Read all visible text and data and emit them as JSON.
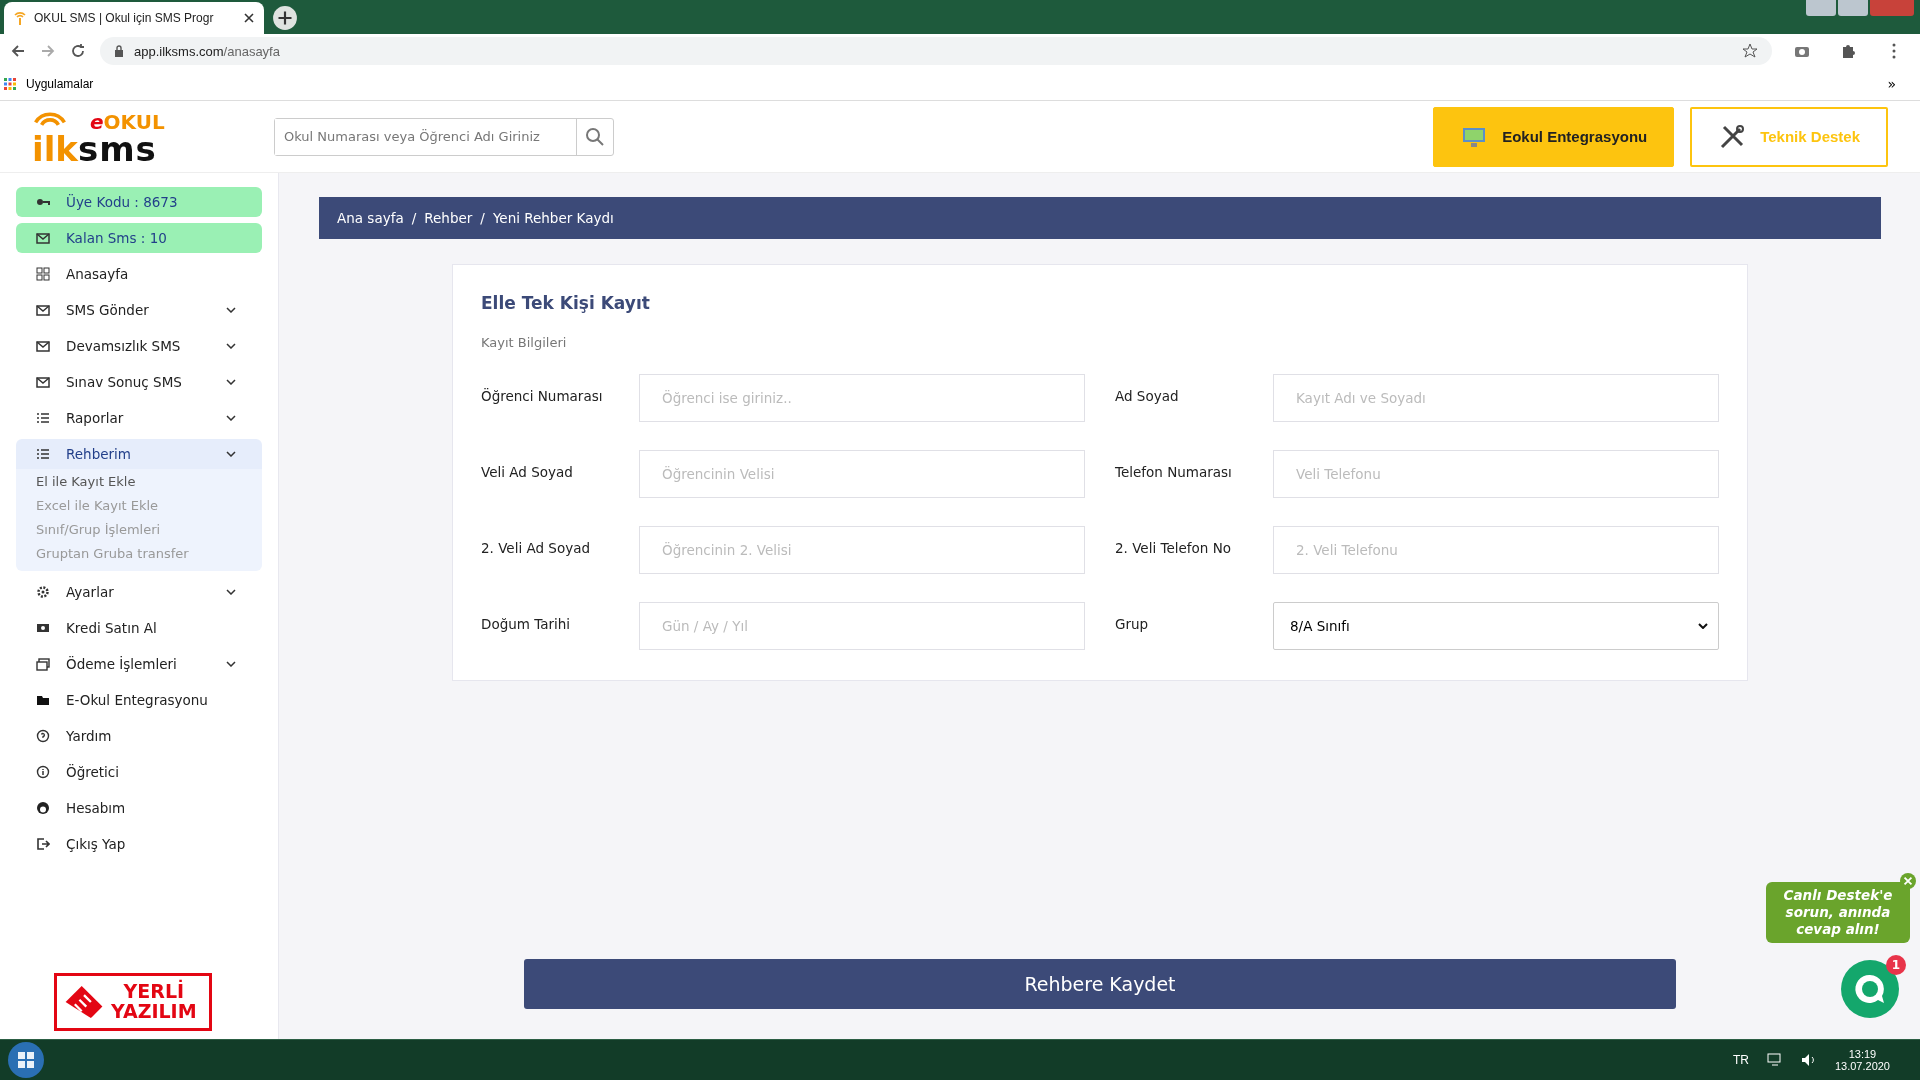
{
  "browser": {
    "tab_title": "OKUL SMS | Okul için SMS Progr",
    "url_host": "app.ilksms.com",
    "url_path": "/anasayfa",
    "bookmarks": [
      "Uygulamalar"
    ],
    "more": "»"
  },
  "header": {
    "logo": {
      "prefix": "e",
      "brand": "OKUL",
      "first": "ilk",
      "second": "sms"
    },
    "search": {
      "placeholder": "Okul Numarası veya Öğrenci Adı Giriniz"
    },
    "buttons": [
      {
        "label": "Eokul Entegrasyonu",
        "kind": "primary"
      },
      {
        "label": "Teknik Destek",
        "kind": "outline"
      }
    ]
  },
  "sidebar": {
    "items": [
      {
        "label": "Üye Kodu : 8673",
        "kind": "badge",
        "expandable": false,
        "selected": false
      },
      {
        "label": "Kalan Sms : 10",
        "kind": "badge",
        "expandable": false,
        "selected": false
      },
      {
        "label": "Anasayfa",
        "kind": "menu",
        "expandable": false,
        "selected": false
      },
      {
        "label": "SMS Gönder",
        "kind": "menu",
        "expandable": true,
        "selected": false
      },
      {
        "label": "Devamsızlık SMS",
        "kind": "menu",
        "expandable": true,
        "selected": false
      },
      {
        "label": "Sınav Sonuç SMS",
        "kind": "menu",
        "expandable": true,
        "selected": false
      },
      {
        "label": "Raporlar",
        "kind": "menu",
        "expandable": true,
        "selected": false
      },
      {
        "label": "Rehberim",
        "kind": "menu",
        "expandable": true,
        "selected": true,
        "expanded": true,
        "children": [
          {
            "label": "El ile Kayıt Ekle",
            "selected": true
          },
          {
            "label": "Excel ile Kayıt Ekle",
            "selected": false
          },
          {
            "label": "Sınıf/Grup İşlemleri",
            "selected": false
          },
          {
            "label": "Gruptan Gruba transfer",
            "selected": false
          }
        ]
      },
      {
        "label": "Ayarlar",
        "kind": "menu",
        "expandable": true,
        "selected": false
      },
      {
        "label": "Kredi Satın Al",
        "kind": "menu",
        "expandable": false,
        "selected": false
      },
      {
        "label": "Ödeme İşlemleri",
        "kind": "menu",
        "expandable": true,
        "selected": false
      },
      {
        "label": "E-Okul Entegrasyonu",
        "kind": "menu",
        "expandable": false,
        "selected": false
      },
      {
        "label": "Yardım",
        "kind": "menu",
        "expandable": false,
        "selected": false
      },
      {
        "label": "Öğretici",
        "kind": "menu",
        "expandable": false,
        "selected": false
      },
      {
        "label": "Hesabım",
        "kind": "menu",
        "expandable": false,
        "selected": false
      },
      {
        "label": "Çıkış Yap",
        "kind": "menu",
        "expandable": false,
        "selected": false
      }
    ],
    "footer_logo": [
      "YERLİ",
      "YAZILIM"
    ]
  },
  "breadcrumb": {
    "separator": "/",
    "items": [
      "Ana sayfa",
      "Rehber",
      "Yeni Rehber Kaydı"
    ]
  },
  "form": {
    "title": "Elle Tek Kişi Kayıt",
    "subtitle": "Kayıt Bilgileri",
    "fields": [
      {
        "label": "Öğrenci Numarası",
        "kind": "input",
        "placeholder": "Öğrenci ise giriniz.."
      },
      {
        "label": "Ad Soyad",
        "kind": "input",
        "placeholder": "Kayıt Adı ve Soyadı"
      },
      {
        "label": "Veli Ad Soyad",
        "kind": "input",
        "placeholder": "Öğrencinin Velisi"
      },
      {
        "label": "Telefon Numarası",
        "kind": "input",
        "placeholder": "Veli Telefonu"
      },
      {
        "label": "2. Veli Ad Soyad",
        "kind": "input",
        "placeholder": "Öğrencinin 2. Velisi"
      },
      {
        "label": "2. Veli Telefon No",
        "kind": "input",
        "placeholder": "2. Veli Telefonu"
      },
      {
        "label": "Doğum Tarihi",
        "kind": "input",
        "placeholder": "Gün / Ay / Yıl"
      },
      {
        "label": "Grup",
        "kind": "select",
        "value": "8/A Sınıfı"
      }
    ]
  },
  "submit": "Rehbere Kaydet",
  "chat": {
    "bubble": "Canlı Destek'e sorun, anında cevap alın!",
    "unread": "1"
  },
  "taskbar": {
    "language": "TR",
    "time": "13:19",
    "date": "13.07.2020"
  }
}
